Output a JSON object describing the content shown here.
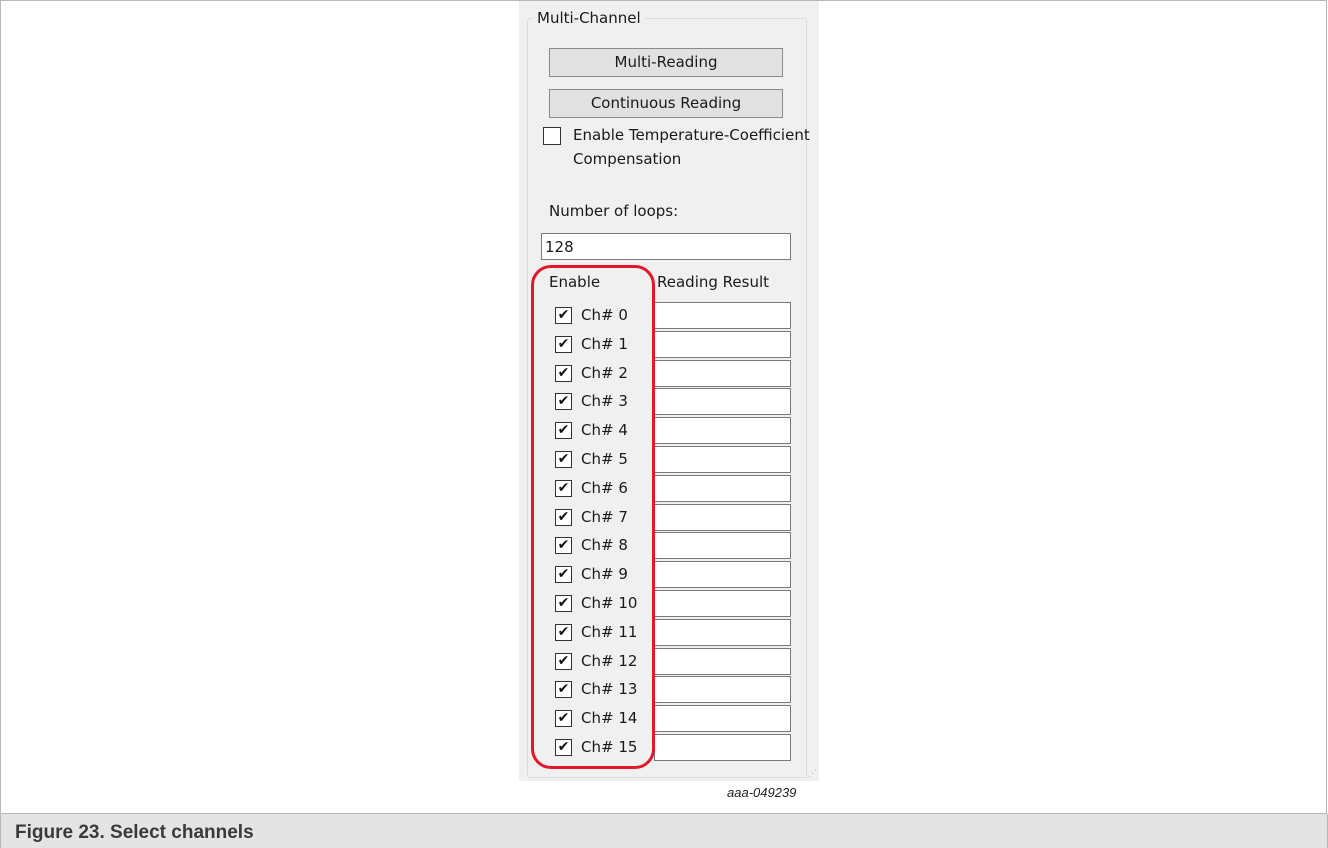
{
  "groupbox": {
    "title": "Multi-Channel"
  },
  "buttons": {
    "multi_reading": "Multi-Reading",
    "continuous_reading": "Continuous Reading"
  },
  "temperature_compensation": {
    "label": "Enable Temperature-Coefficient Compensation",
    "checked": false
  },
  "loops": {
    "label": "Number of loops:",
    "value": "128"
  },
  "table": {
    "header_enable": "Enable",
    "header_result": "Reading Result"
  },
  "channels": [
    {
      "label": "Ch# 0",
      "checked": true,
      "result": ""
    },
    {
      "label": "Ch# 1",
      "checked": true,
      "result": ""
    },
    {
      "label": "Ch# 2",
      "checked": true,
      "result": ""
    },
    {
      "label": "Ch# 3",
      "checked": true,
      "result": ""
    },
    {
      "label": "Ch# 4",
      "checked": true,
      "result": ""
    },
    {
      "label": "Ch# 5",
      "checked": true,
      "result": ""
    },
    {
      "label": "Ch# 6",
      "checked": true,
      "result": ""
    },
    {
      "label": "Ch# 7",
      "checked": true,
      "result": ""
    },
    {
      "label": "Ch# 8",
      "checked": true,
      "result": ""
    },
    {
      "label": "Ch# 9",
      "checked": true,
      "result": ""
    },
    {
      "label": "Ch# 10",
      "checked": true,
      "result": ""
    },
    {
      "label": "Ch# 11",
      "checked": true,
      "result": ""
    },
    {
      "label": "Ch# 12",
      "checked": true,
      "result": ""
    },
    {
      "label": "Ch# 13",
      "checked": true,
      "result": ""
    },
    {
      "label": "Ch# 14",
      "checked": true,
      "result": ""
    },
    {
      "label": "Ch# 15",
      "checked": true,
      "result": ""
    }
  ],
  "figure_id": "aaa-049239",
  "caption": "Figure 23.  Select channels",
  "colors": {
    "highlight": "#e2192c",
    "panel_bg": "#f0f0f0",
    "caption_bg": "#e4e4e4"
  }
}
